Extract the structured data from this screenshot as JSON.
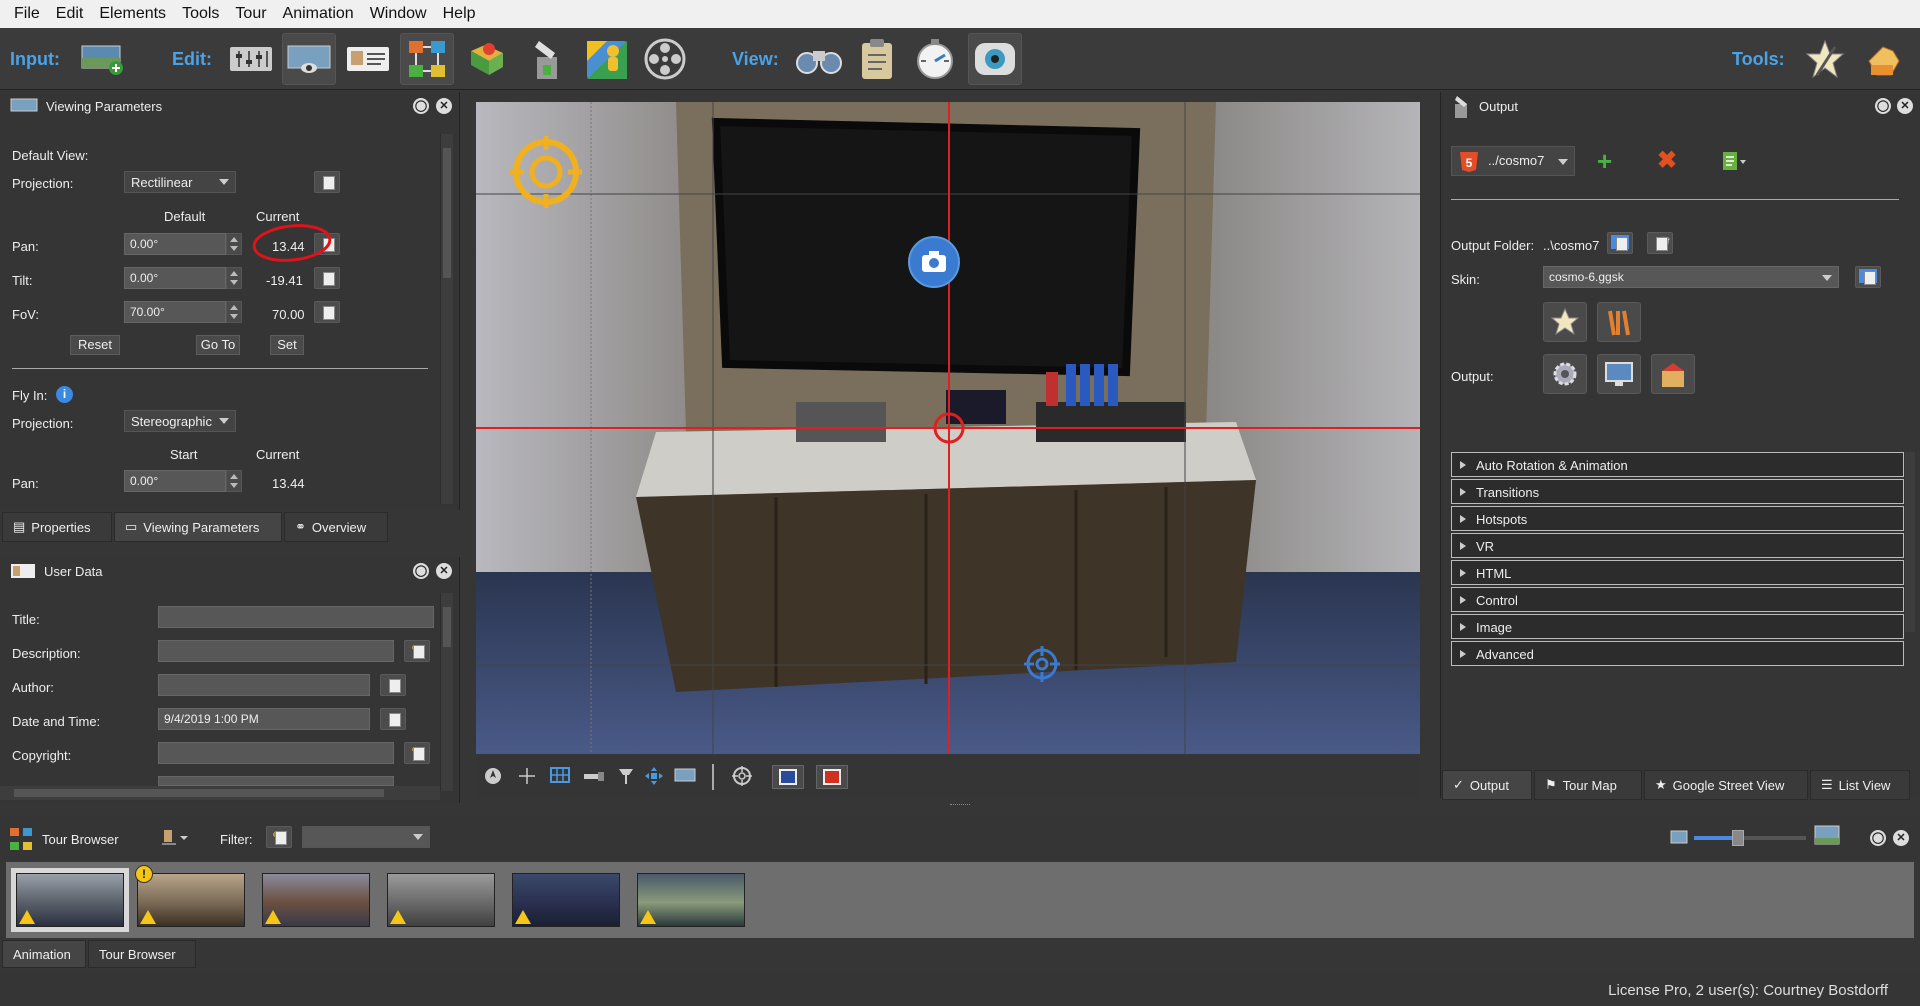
{
  "menu": [
    "File",
    "Edit",
    "Elements",
    "Tools",
    "Tour",
    "Animation",
    "Window",
    "Help"
  ],
  "toolbar": {
    "input_label": "Input:",
    "edit_label": "Edit:",
    "view_label": "View:",
    "tools_label": "Tools:"
  },
  "viewing_params": {
    "title": "Viewing Parameters",
    "default_view": "Default View:",
    "projection_label": "Projection:",
    "projection_value": "Rectilinear",
    "col_default": "Default",
    "col_current": "Current",
    "pan_label": "Pan:",
    "pan_default": "0.00°",
    "pan_current": "13.44",
    "tilt_label": "Tilt:",
    "tilt_default": "0.00°",
    "tilt_current": "-19.41",
    "fov_label": "FoV:",
    "fov_default": "70.00°",
    "fov_current": "70.00",
    "reset": "Reset",
    "goto": "Go To",
    "set": "Set",
    "fly_in": "Fly In:",
    "fly_projection_label": "Projection:",
    "fly_projection_value": "Stereographic",
    "col_start": "Start",
    "fly_col_current": "Current",
    "fly_pan_label": "Pan:",
    "fly_pan_start": "0.00°",
    "fly_pan_current": "13.44"
  },
  "left_tabs": [
    "Properties",
    "Viewing Parameters",
    "Overview"
  ],
  "user_data": {
    "title": "User Data",
    "title_label": "Title:",
    "description_label": "Description:",
    "author_label": "Author:",
    "datetime_label": "Date and Time:",
    "datetime_value": "9/4/2019 1:00 PM",
    "copyright_label": "Copyright:"
  },
  "output": {
    "title": "Output",
    "target": "../cosmo7",
    "folder_label": "Output Folder:",
    "folder_value": "..\\cosmo7",
    "skin_label": "Skin:",
    "skin_value": "cosmo-6.ggsk",
    "output_label": "Output:",
    "sections": [
      "Auto Rotation & Animation",
      "Transitions",
      "Hotspots",
      "VR",
      "HTML",
      "Control",
      "Image",
      "Advanced"
    ]
  },
  "right_tabs": [
    "Output",
    "Tour Map",
    "Google Street View",
    "List View"
  ],
  "tour_browser": {
    "title": "Tour Browser",
    "filter_label": "Filter:"
  },
  "bottom_tabs": [
    "Animation",
    "Tour Browser"
  ],
  "status": "License Pro, 2 user(s): Courtney Bostdorff",
  "thumbnails": [
    {
      "warning": true,
      "selected": true,
      "badge": false,
      "colors": [
        "#9aa0a8",
        "#5a606a",
        "#2a3040"
      ]
    },
    {
      "warning": true,
      "selected": false,
      "badge": true,
      "colors": [
        "#b8a58a",
        "#7a6a55",
        "#3a3025"
      ]
    },
    {
      "warning": true,
      "selected": false,
      "badge": false,
      "colors": [
        "#8a8a9a",
        "#6a5040",
        "#3a3a4a"
      ]
    },
    {
      "warning": true,
      "selected": false,
      "badge": false,
      "colors": [
        "#9a9a9a",
        "#6a6a6a",
        "#404040"
      ]
    },
    {
      "warning": true,
      "selected": false,
      "badge": false,
      "colors": [
        "#3a4a6a",
        "#2a3050",
        "#1a2030"
      ]
    },
    {
      "warning": true,
      "selected": false,
      "badge": false,
      "colors": [
        "#4a5a6a",
        "#8a9a7a",
        "#2a3a3a"
      ]
    }
  ],
  "colors": {
    "accent": "#4aa3e8",
    "crosshair": "#e02020",
    "panel": "#353535"
  }
}
